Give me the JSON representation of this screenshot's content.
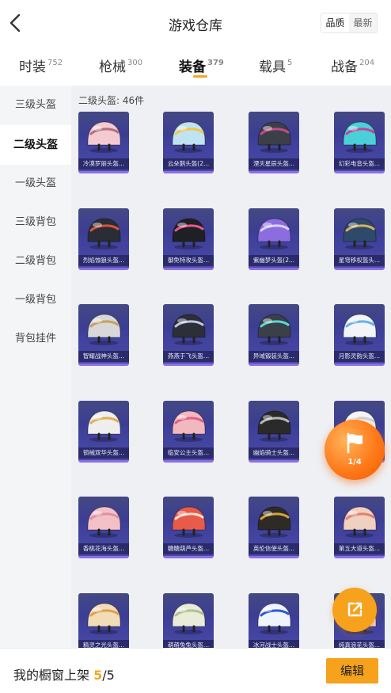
{
  "header": {
    "title": "游戏仓库",
    "sort_options": [
      "品质",
      "最新"
    ],
    "active_sort": "品质"
  },
  "tabs": [
    {
      "label": "时装",
      "count": "752",
      "active": false
    },
    {
      "label": "枪械",
      "count": "300",
      "active": false
    },
    {
      "label": "装备",
      "count": "379",
      "active": true
    },
    {
      "label": "载具",
      "count": "5",
      "active": false
    },
    {
      "label": "战备",
      "count": "204",
      "active": false
    }
  ],
  "sidebar": {
    "items": [
      {
        "label": "三级头盔",
        "active": false
      },
      {
        "label": "二级头盔",
        "active": true
      },
      {
        "label": "一级头盔",
        "active": false
      },
      {
        "label": "三级背包",
        "active": false
      },
      {
        "label": "二级背包",
        "active": false
      },
      {
        "label": "一级背包",
        "active": false
      },
      {
        "label": "背包挂件",
        "active": false
      }
    ]
  },
  "content": {
    "count_label": "二级头盔: 46件",
    "items": [
      {
        "name": "冷漠罗丽头盔...",
        "color": "#f3c9d2",
        "accent": "#b07080"
      },
      {
        "name": "云朵鹅头盔(2...",
        "color": "#bfe3f2",
        "accent": "#f5c542"
      },
      {
        "name": "湮灭星辰头盔...",
        "color": "#3b3f48",
        "accent": "#c44a8a"
      },
      {
        "name": "幻彩电音头盔...",
        "color": "#4ad0d8",
        "accent": "#c8409a"
      },
      {
        "name": "烈焰蚀狼头盔...",
        "color": "#2a2d35",
        "accent": "#d8553a"
      },
      {
        "name": "御免特攻头盔...",
        "color": "#1e2026",
        "accent": "#e85a8c"
      },
      {
        "name": "紫幽梦头盔(2...",
        "color": "#8b6de0",
        "accent": "#d8d0ff"
      },
      {
        "name": "星穹移权盔头...",
        "color": "#2d4a6a",
        "accent": "#d8b060"
      },
      {
        "name": "智耀战神头盔...",
        "color": "#d8d8d8",
        "accent": "#c8a060"
      },
      {
        "name": "燕燕于飞头盔...",
        "color": "#2c2f38",
        "accent": "#c0c8e0"
      },
      {
        "name": "异域锻装头盔...",
        "color": "#3a3f48",
        "accent": "#5ad8d0"
      },
      {
        "name": "月影灵韵头盔...",
        "color": "#f2f4f8",
        "accent": "#6ab0e8"
      },
      {
        "name": "锁械双华头盔...",
        "color": "#eeeeee",
        "accent": "#e0b050"
      },
      {
        "name": "临安公主头盔...",
        "color": "#f2b8c0",
        "accent": "#e06080"
      },
      {
        "name": "幽焰骑士头盔...",
        "color": "#2a2a2a",
        "accent": "#b8b8b8"
      },
      {
        "name": "",
        "color": "#f4f4f4",
        "accent": "#d0d0d0"
      },
      {
        "name": "香桃花海头盔...",
        "color": "#f4c0c8",
        "accent": "#e090a0"
      },
      {
        "name": "糖糖葫芦头盔...",
        "color": "#e85a4a",
        "accent": "#f4e0d0"
      },
      {
        "name": "英伦信使头盔...",
        "color": "#2e2a26",
        "accent": "#d8a040"
      },
      {
        "name": "第五大道头盔...",
        "color": "#f0d0c0",
        "accent": "#e08070"
      },
      {
        "name": "精灵之光头盔...",
        "color": "#f2dcb8",
        "accent": "#e0a050"
      },
      {
        "name": "萌萌兔兔头盔...",
        "color": "#e8ecd8",
        "accent": "#b0c090"
      },
      {
        "name": "冰河战士头盔...",
        "color": "#f0f4ff",
        "accent": "#2a5ad8"
      },
      {
        "name": "纯真浪花头盔...",
        "color": "#f4d0d8",
        "accent": "#90c0e0"
      }
    ]
  },
  "float_ball": {
    "page": "1/4"
  },
  "bottom_bar": {
    "label": "我的橱窗上架",
    "used": "5",
    "total": "/5",
    "edit_label": "编辑"
  },
  "colors": {
    "accent": "#f7a21c",
    "card_bg": "#3d3f98",
    "card_border": "#8c6fe6"
  }
}
